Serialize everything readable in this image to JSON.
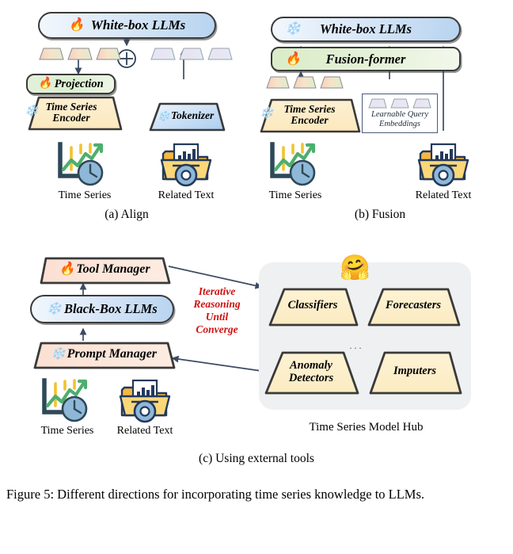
{
  "figure": {
    "caption": "Figure 5: Different directions for incorporating time series knowledge to LLMs.",
    "subcaptions": {
      "a": "(a) Align",
      "b": "(b) Fusion",
      "c": "(c) Using external tools"
    }
  },
  "colors": {
    "llm_blue": "#b8d4f0",
    "module_green": "#dcefd2",
    "encoder_cream": "#fdecc8",
    "manager_peach": "#fbe2d5",
    "hub_bg": "#eff0f1",
    "hub_model_cream": "#fdf0cd",
    "arrow": "#3c4a63",
    "red_text": "#cf1111",
    "outline": "#3a3a3a"
  },
  "panel_a": {
    "llm_box": {
      "label": "White-box LLMs",
      "state_icon": "flame-icon"
    },
    "projection_box": {
      "label": "Projection",
      "state_icon": "flame-icon"
    },
    "encoder_trapezoid": {
      "label": "Time Series\nEncoder",
      "label_line1": "Time Series",
      "label_line2": "Encoder",
      "state_icon": "snowflake-icon"
    },
    "tokenizer_trapezoid": {
      "label": "Tokenizer",
      "state_icon": "snowflake-icon"
    },
    "plus_operator": "⊕",
    "ts_tokens_count": 3,
    "text_tokens_count": 3,
    "inputs": [
      {
        "icon": "time-series-chart-icon",
        "label": "Time Series"
      },
      {
        "icon": "related-text-folder-icon",
        "label": "Related Text"
      }
    ]
  },
  "panel_b": {
    "llm_box": {
      "label": "White-box LLMs",
      "state_icon": "snowflake-icon"
    },
    "fusion_box": {
      "label": "Fusion-former",
      "state_icon": "flame-icon"
    },
    "encoder_trapezoid": {
      "label_line1": "Time Series",
      "label_line2": "Encoder",
      "state_icon": "snowflake-icon"
    },
    "query_box": {
      "label_line1": "Learnable Query",
      "label_line2": "Embeddings",
      "tokens_count": 3
    },
    "ts_tokens_count": 3,
    "inputs": [
      {
        "icon": "time-series-chart-icon",
        "label": "Time Series"
      },
      {
        "icon": "related-text-folder-icon",
        "label": "Related Text"
      }
    ]
  },
  "panel_c": {
    "tool_manager": {
      "label": "Tool Manager",
      "state_icon": "flame-icon"
    },
    "llm_box": {
      "label": "Black-Box LLMs",
      "state_icon": "snowflake-icon"
    },
    "prompt_manager": {
      "label": "Prompt Manager",
      "state_icon": "snowflake-icon"
    },
    "loop_text": {
      "line1": "Iterative",
      "line2": "Reasoning",
      "line3": "Until",
      "line4": "Converge"
    },
    "inputs": [
      {
        "icon": "time-series-chart-icon",
        "label": "Time Series"
      },
      {
        "icon": "related-text-folder-icon",
        "label": "Related Text"
      }
    ],
    "hub": {
      "title": "Time Series Model Hub",
      "logo_icon": "hugging-face-icon",
      "ellipsis": "···",
      "models": [
        {
          "label": "Classifiers"
        },
        {
          "label": "Forecasters"
        },
        {
          "label_line1": "Anomaly",
          "label_line2": "Detectors"
        },
        {
          "label": "Imputers"
        }
      ]
    }
  }
}
